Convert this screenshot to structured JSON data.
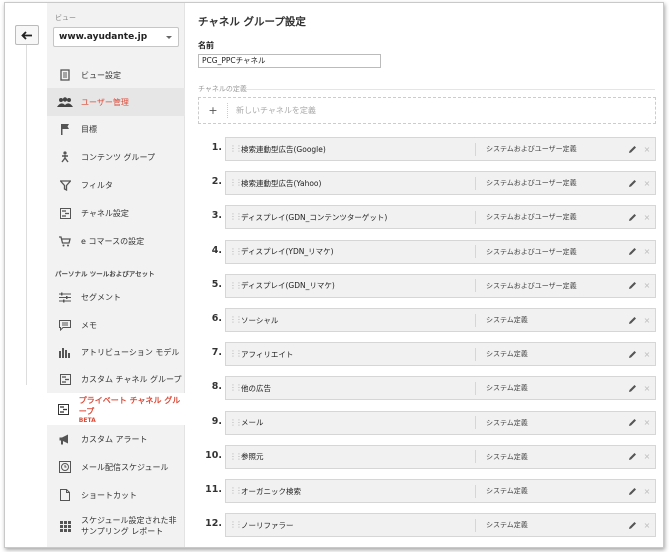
{
  "view": {
    "label": "ビュー",
    "selected": "www.ayudante.jp"
  },
  "sidebar": {
    "items": [
      {
        "label": "ビュー設定",
        "icon": "document-icon"
      },
      {
        "label": "ユーザー管理",
        "icon": "users-icon"
      },
      {
        "label": "目標",
        "icon": "flag-icon"
      },
      {
        "label": "コンテンツ グループ",
        "icon": "person-icon"
      },
      {
        "label": "フィルタ",
        "icon": "filter-icon"
      },
      {
        "label": "チャネル設定",
        "icon": "channel-icon"
      },
      {
        "label": "e コマースの設定",
        "icon": "cart-icon"
      }
    ],
    "section_label": "パーソナル ツールおよびアセット",
    "personal_items": [
      {
        "label": "セグメント",
        "icon": "segment-icon"
      },
      {
        "label": "メモ",
        "icon": "note-icon"
      },
      {
        "label": "アトリビューション モデル",
        "icon": "bars-icon"
      },
      {
        "label": "カスタム チャネル グループ",
        "icon": "channel-icon"
      },
      {
        "label": "プライベート チャネル グループ",
        "badge": "BETA",
        "icon": "channel-icon"
      },
      {
        "label": "カスタム アラート",
        "icon": "megaphone-icon"
      },
      {
        "label": "メール配信スケジュール",
        "icon": "clock-icon"
      },
      {
        "label": "ショートカット",
        "icon": "doc-icon"
      },
      {
        "label": "スケジュール設定された非サンプリング レポート",
        "icon": "grid-icon"
      }
    ]
  },
  "main": {
    "title": "チャネル グループ設定",
    "name_label": "名前",
    "name_value": "PCG_PPCチャネル",
    "definition_label": "チャネルの定義",
    "new_channel_plus": "+",
    "new_channel_label": "新しいチャネルを定義",
    "channels": [
      {
        "num": "1.",
        "name": "検索連動型広告(Google)",
        "type": "システムおよびユーザー定義"
      },
      {
        "num": "2.",
        "name": "検索連動型広告(Yahoo)",
        "type": "システムおよびユーザー定義"
      },
      {
        "num": "3.",
        "name": "ディスプレイ(GDN_コンテンツターゲット)",
        "type": "システムおよびユーザー定義"
      },
      {
        "num": "4.",
        "name": "ディスプレイ(YDN_リマケ)",
        "type": "システムおよびユーザー定義"
      },
      {
        "num": "5.",
        "name": "ディスプレイ(GDN_リマケ)",
        "type": "システムおよびユーザー定義"
      },
      {
        "num": "6.",
        "name": "ソーシャル",
        "type": "システム定義"
      },
      {
        "num": "7.",
        "name": "アフィリエイト",
        "type": "システム定義"
      },
      {
        "num": "8.",
        "name": "他の広告",
        "type": "システム定義"
      },
      {
        "num": "9.",
        "name": "メール",
        "type": "システム定義"
      },
      {
        "num": "10.",
        "name": "参照元",
        "type": "システム定義"
      },
      {
        "num": "11.",
        "name": "オーガニック検索",
        "type": "システム定義"
      },
      {
        "num": "12.",
        "name": "ノーリファラー",
        "type": "システム定義"
      }
    ]
  },
  "colors": {
    "accent": "#dd4b39",
    "sidebar_bg": "#f2f2f2",
    "row_bg": "#f1f1f1"
  }
}
